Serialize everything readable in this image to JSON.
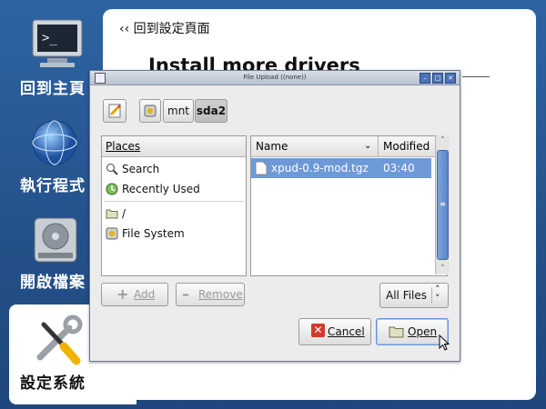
{
  "launcher": {
    "home_label": "回到主頁",
    "apps_label": "執行程式",
    "files_label": "開啟檔案",
    "settings_label": "設定系統"
  },
  "panel": {
    "back_link": "‹‹ 回到設定頁面",
    "title": "Install more drivers"
  },
  "dialog": {
    "title": "File Upload ((none))",
    "breadcrumbs": [
      "mnt",
      "sda2"
    ],
    "places_header": "Places",
    "places": [
      {
        "label": "Search",
        "icon": "magnifier-icon"
      },
      {
        "label": "Recently Used",
        "icon": "recent-icon"
      },
      {
        "label": "/",
        "icon": "folder-icon"
      },
      {
        "label": "File System",
        "icon": "drive-icon"
      }
    ],
    "columns": {
      "name": "Name",
      "modified": "Modified"
    },
    "files": [
      {
        "name": "xpud-0.9-mod.tgz",
        "modified": "03:40",
        "selected": true
      }
    ],
    "add_label": "Add",
    "remove_label": "Remove",
    "filter_value": "All Files",
    "cancel_label": "Cancel",
    "open_label": "Open"
  },
  "colors": {
    "desktop_blue": "#2a5a96",
    "selection_blue": "#6e99d8",
    "cancel_red": "#d23a2a"
  }
}
